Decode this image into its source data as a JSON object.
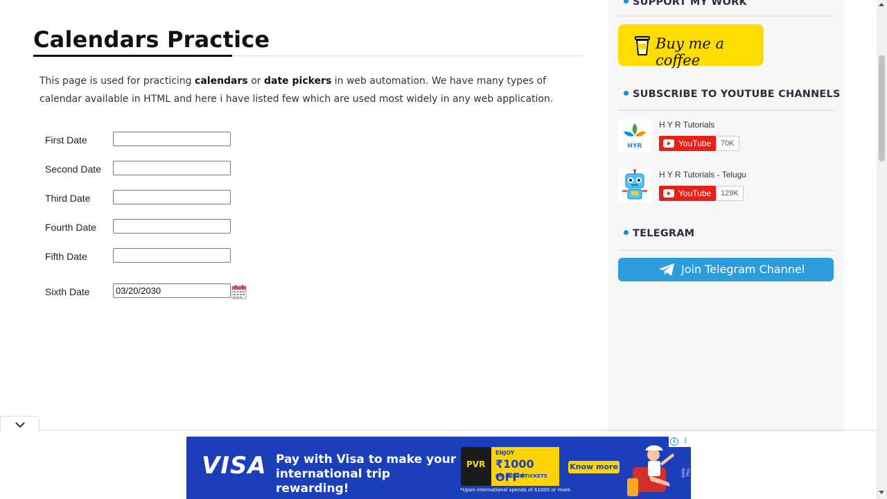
{
  "main": {
    "title": "Calendars Practice",
    "intro": {
      "part1": "This page is used for practicing ",
      "bold1": "calendars",
      "part2": " or ",
      "bold2": "date pickers",
      "part3": " in web automation. We have many types of calendar available in HTML and here i have listed few which are used most widely in any web application."
    },
    "fields": [
      {
        "label": "First Date",
        "value": ""
      },
      {
        "label": "Second Date",
        "value": ""
      },
      {
        "label": "Third Date",
        "value": ""
      },
      {
        "label": "Fourth Date",
        "value": ""
      },
      {
        "label": "Fifth Date",
        "value": ""
      },
      {
        "label": "Sixth Date",
        "value": "03/20/2030"
      }
    ],
    "calendar_icon": "calendar-icon"
  },
  "sidebar": {
    "support": {
      "title": "SUPPORT MY WORK",
      "button_label": "Buy me a coffee"
    },
    "youtube": {
      "title": "SUBSCRIBE TO YOUTUBE CHANNELS",
      "channels": [
        {
          "name": "H Y R Tutorials",
          "button_label": "YouTube",
          "count": "70K"
        },
        {
          "name": "H Y R Tutorials - Telugu",
          "button_label": "YouTube",
          "count": "129K"
        }
      ]
    },
    "telegram": {
      "title": "TELEGRAM",
      "button_label": "Join Telegram Channel"
    },
    "accent_color": "#1e88e5"
  },
  "ad": {
    "brand": "VISA",
    "message": "Pay with Visa to make your international trip rewarding!",
    "partner": "PVR",
    "offer_top": "ENJOY",
    "offer_amount": "₹1000 OFF*",
    "offer_sub": "ON MOVIE TICKETS",
    "cta": "Know more",
    "fine_print": "*Upon international spends of $1000 or more.",
    "tc": "*T&C Apply"
  }
}
